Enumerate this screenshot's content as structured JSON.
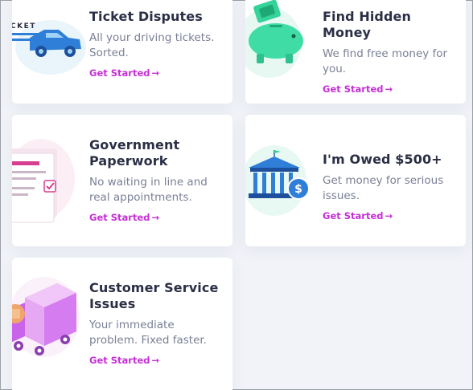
{
  "cards": [
    {
      "title": "Ticket Disputes",
      "description": "All your driving tickets. Sorted.",
      "cta": "Get Started",
      "illustration_text": "CKET",
      "icon": "car-ticket-icon"
    },
    {
      "title": "Find Hidden Money",
      "description": "We find free money for you.",
      "cta": "Get Started",
      "icon": "piggy-bank-icon"
    },
    {
      "title": "Government Paperwork",
      "description": "No waiting in line and real appointments.",
      "cta": "Get Started",
      "icon": "document-checkbox-icon"
    },
    {
      "title": "I'm Owed $500+",
      "description": "Get money for serious issues.",
      "cta": "Get Started",
      "icon": "bank-dollar-icon",
      "coin_symbol": "$"
    },
    {
      "title": "Customer Service Issues",
      "description": "Your immediate problem. Fixed faster.",
      "cta": "Get Started",
      "icon": "delivery-truck-icon"
    }
  ],
  "arrow_glyph": "→",
  "colors": {
    "background": "#f1f3f8",
    "card": "#ffffff",
    "title": "#2b2f45",
    "description": "#7a8095",
    "cta": "#c62fd6",
    "blue": "#2f7fd8",
    "green": "#34d39a",
    "pink": "#d63f8f",
    "violet": "#d57df0"
  }
}
